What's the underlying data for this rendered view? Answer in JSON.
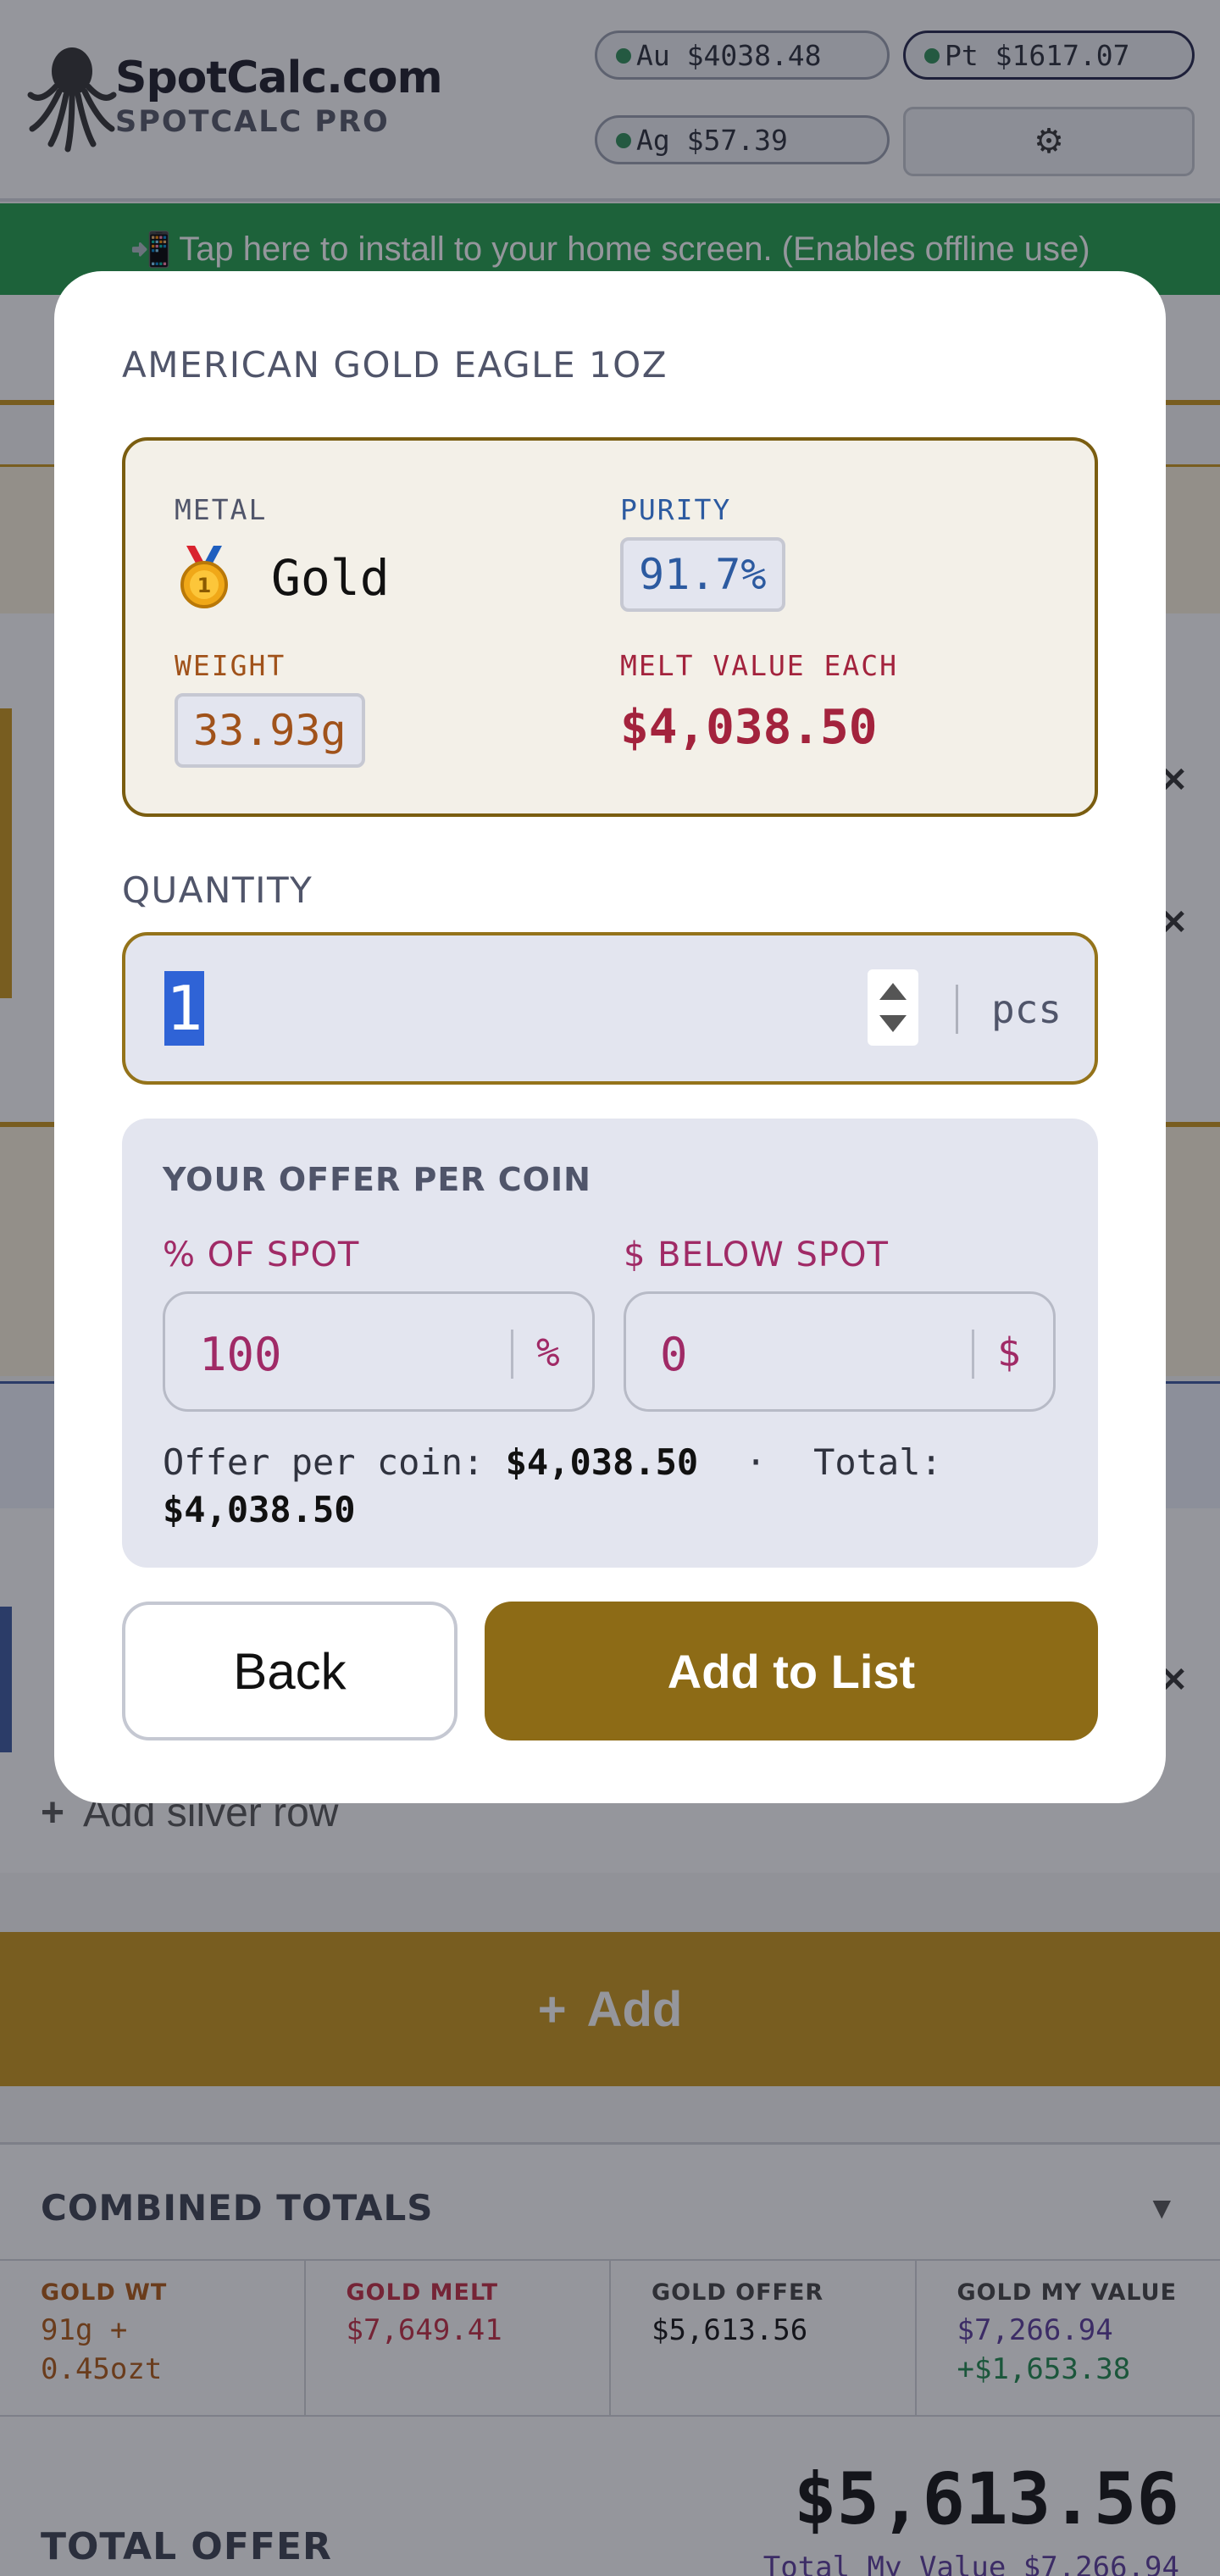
{
  "header": {
    "brand_name": "SpotCalc.com",
    "brand_sub": "SPOTCALC PRO",
    "prices": {
      "au": "Au $4038.48",
      "pt": "Pt $1617.07",
      "ag": "Ag $57.39"
    },
    "settings_icon": "⚙"
  },
  "banner": {
    "icon": "📲",
    "text": "Tap here to install to your home screen. (Enables offline use)"
  },
  "background": {
    "add_silver_row": "Add silver row",
    "add_button": "Add",
    "combined_totals": "COMBINED TOTALS",
    "totals": [
      {
        "label": "GOLD WT",
        "value": "91g +\n0.45ozt",
        "color": "#b05a14"
      },
      {
        "label": "GOLD MELT",
        "value": "$7,649.41",
        "color": "#c42d43"
      },
      {
        "label": "GOLD OFFER",
        "value": "$5,613.56",
        "color": "#111111"
      },
      {
        "label": "GOLD MY VALUE",
        "value": "$7,266.94",
        "extra": "+$1,653.38",
        "color": "#5b3c9b"
      }
    ],
    "total_offer_label": "TOTAL OFFER",
    "total_offer_value": "$5,613.56",
    "total_my_value": "Total My Value $7,266.94"
  },
  "modal": {
    "title": "AMERICAN GOLD EAGLE 1OZ",
    "metal_label": "METAL",
    "metal_value": "Gold",
    "purity_label": "PURITY",
    "purity_value": "91.7%",
    "weight_label": "WEIGHT",
    "weight_value": "33.93g",
    "melt_label": "MELT VALUE EACH",
    "melt_value": "$4,038.50",
    "quantity_label": "QUANTITY",
    "quantity_value": "1",
    "quantity_unit": "pcs",
    "offer_title": "YOUR OFFER PER COIN",
    "pct_label": "% OF SPOT",
    "pct_value": "100",
    "pct_unit": "%",
    "below_label": "$ BELOW SPOT",
    "below_value": "0",
    "below_unit": "$",
    "offer_prefix": "Offer per coin:",
    "offer_value": "$4,038.50",
    "dot": "·",
    "total_prefix": "Total:",
    "total_value": "$4,038.50",
    "back_button": "Back",
    "add_button": "Add to List"
  },
  "colors": {
    "gold": "#8d6b16",
    "modal_gold_border": "#7a5d10",
    "purity": "#2c5aa0",
    "weight": "#a0521a",
    "melt": "#a3233d",
    "offer": "#a02a66",
    "banner": "#22a04a"
  }
}
